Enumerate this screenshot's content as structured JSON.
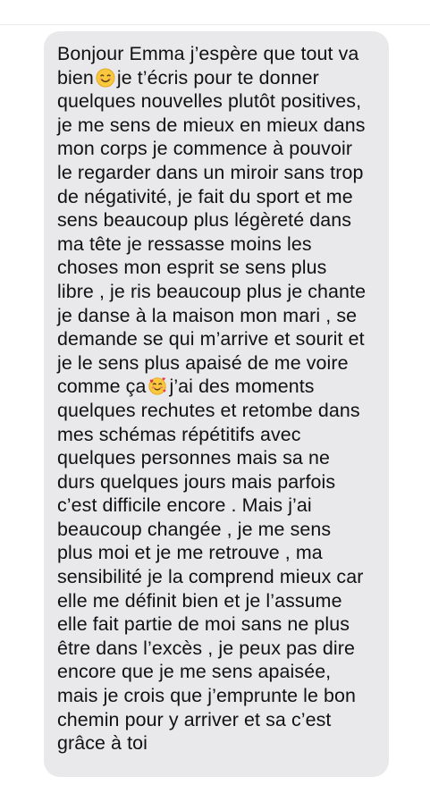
{
  "message": {
    "lines": [
      "Bonjour Emma j’espère que tout va",
      "bien",
      "je t’écris pour te donner",
      "quelques nouvelles plutôt positives,",
      "je me sens de mieux en mieux dans",
      "mon corps je commence à pouvoir",
      "le regarder dans un miroir sans trop",
      "de négativité, je fait du sport et me",
      "sens beaucoup plus légèreté dans",
      "ma tête je ressasse moins les",
      "choses mon esprit se sens plus",
      "libre , je ris beaucoup plus je chante",
      "je danse à la maison mon mari , se",
      "demande se qui m’arrive et sourit et",
      "je le sens plus apaisé de me voire",
      "comme ça",
      "j’ai des moments",
      "quelques rechutes et retombe dans",
      "mes schémas répétitifs avec",
      "quelques personnes mais sa ne",
      "durs quelques jours mais parfois",
      "c’est difficile encore . Mais j’ai",
      "beaucoup changée , je me sens",
      "plus moi et je me retrouve , ma",
      "sensibilité je la comprend mieux car",
      "elle me définit bien et je l’assume",
      "elle fait partie de moi sans ne plus",
      "être dans l’excès , je peux pas dire",
      "encore que je me sens apaisée,",
      "mais je crois que j’emprunte le bon",
      "chemin pour y arriver et sa c’est",
      "grâce à toi"
    ],
    "emojis": {
      "smile": "smiling-face-emoji",
      "hearts": "smiling-face-with-hearts-emoji"
    }
  },
  "colors": {
    "bubble": "#e9e9eb",
    "text": "#111111",
    "emoji_face": "#f9c83c"
  }
}
